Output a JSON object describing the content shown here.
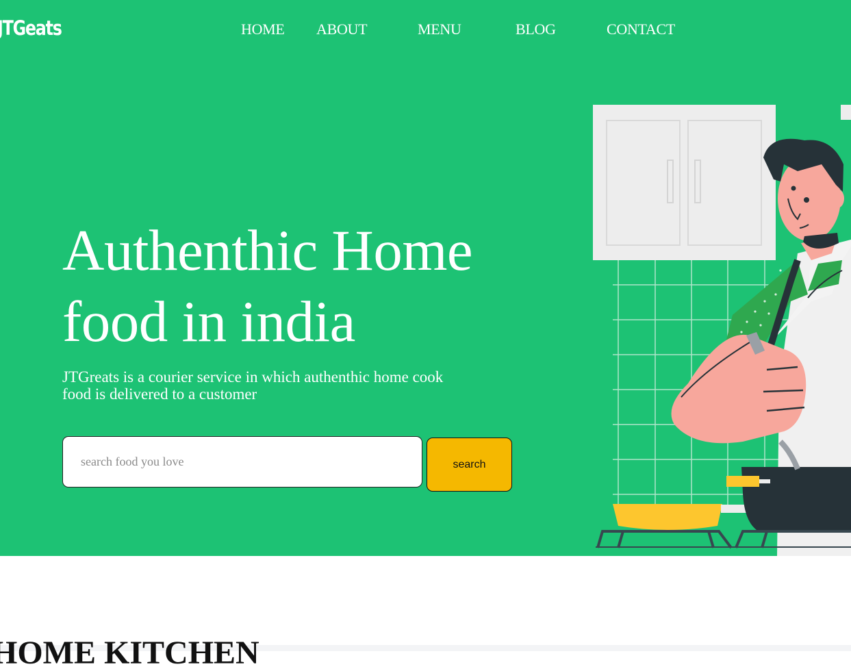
{
  "header": {
    "logo": "JTGeats"
  },
  "nav": {
    "items": [
      {
        "label": "HOME"
      },
      {
        "label": "ABOUT"
      },
      {
        "label": "MENU"
      },
      {
        "label": "BLOG"
      },
      {
        "label": "CONTACT"
      }
    ]
  },
  "hero": {
    "title_line1": "Authenthic Home",
    "title_line2": "food in india",
    "description": "JTGreats is a courier service in which authenthic home cook food is delivered to a customer",
    "search": {
      "placeholder": "search food you love",
      "value": "",
      "button_label": "search"
    },
    "illustration": "chef-cooking-illustration"
  },
  "section": {
    "title": "HOME KITCHEN"
  },
  "colors": {
    "hero_background": "#1dc274",
    "button": "#f5b800",
    "text_light": "#ffffff"
  }
}
